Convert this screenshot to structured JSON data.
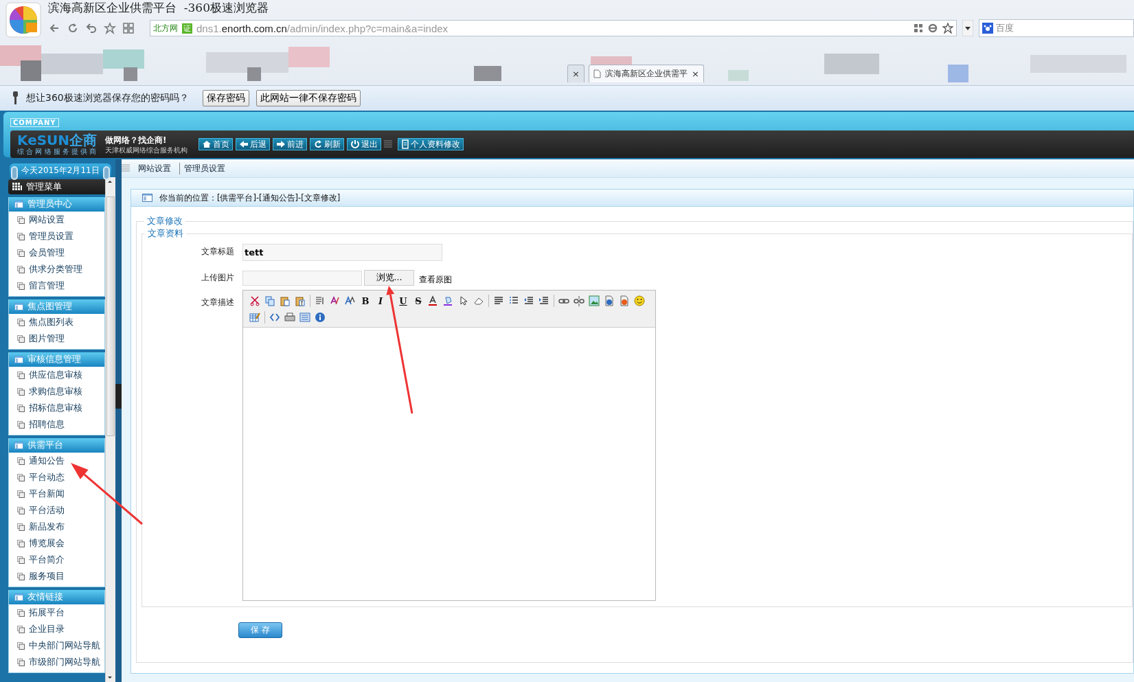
{
  "window": {
    "title": "滨海高新区企业供需平台  -360极速浏览器"
  },
  "address_bar": {
    "site_label": "北方网",
    "verified_badge": "证",
    "url_prefix": "dns1.",
    "url_domain": "enorth.com.cn",
    "url_path": "/admin/index.php?c=main&a=index"
  },
  "search_box": {
    "value": "百度"
  },
  "tabs": [
    {
      "close": "×",
      "selected": false
    },
    {
      "label": "滨海高新区企业供需平",
      "close": "×",
      "selected": true
    }
  ],
  "password_bar": {
    "message": "想让360极速浏览器保存您的密码吗？",
    "buttons": [
      "保存密码",
      "此网站一律不保存密码"
    ]
  },
  "header": {
    "badge": "COMPANY",
    "logo_latin": "KeSUN",
    "logo_cn": "企商",
    "logo_sub": "综 合 网 络 服 务 提 供 商",
    "slogan": "做网络？找企商!",
    "slogan_sub": "天津权威网络综合服务机构",
    "nav": [
      "首页",
      "后退",
      "前进",
      "刷新",
      "退出"
    ],
    "profile_button": "个人资料修改"
  },
  "date": "今天2015年2月11日",
  "top_links": [
    "网站设置",
    "管理员设置"
  ],
  "sidebar": {
    "title": "管理菜单",
    "groups": [
      {
        "title": "管理员中心",
        "items": [
          "网站设置",
          "管理员设置",
          "会员管理",
          "供求分类管理",
          "留言管理"
        ]
      },
      {
        "title": "焦点图管理",
        "items": [
          "焦点图列表",
          "图片管理"
        ]
      },
      {
        "title": "审核信息管理",
        "items": [
          "供应信息审核",
          "求购信息审核",
          "招标信息审核",
          "招聘信息"
        ]
      },
      {
        "title": "供需平台",
        "items": [
          "通知公告",
          "平台动态",
          "平台新闻",
          "平台活动",
          "新品发布",
          "博览展会",
          "平台简介",
          "服务项目"
        ]
      },
      {
        "title": "友情链接",
        "items": [
          "拓展平台",
          "企业目录",
          "中央部门网站导航",
          "市级部门网站导航"
        ]
      }
    ]
  },
  "breadcrumb": "你当前的位置：[供需平台]-[通知公告]-[文章修改]",
  "form": {
    "legend": "文章修改",
    "section_legend": "文章资料",
    "title_label": "文章标题",
    "title_value": "tett",
    "image_label": "上传图片",
    "browse_button": "浏览...",
    "view_link": "查看原图",
    "description_label": "文章描述",
    "format_buttons": [
      "B",
      "I",
      "U",
      "S"
    ],
    "save_button": "保 存"
  },
  "annotations": [
    {
      "kind": "arrow"
    },
    {
      "kind": "arrow"
    }
  ]
}
